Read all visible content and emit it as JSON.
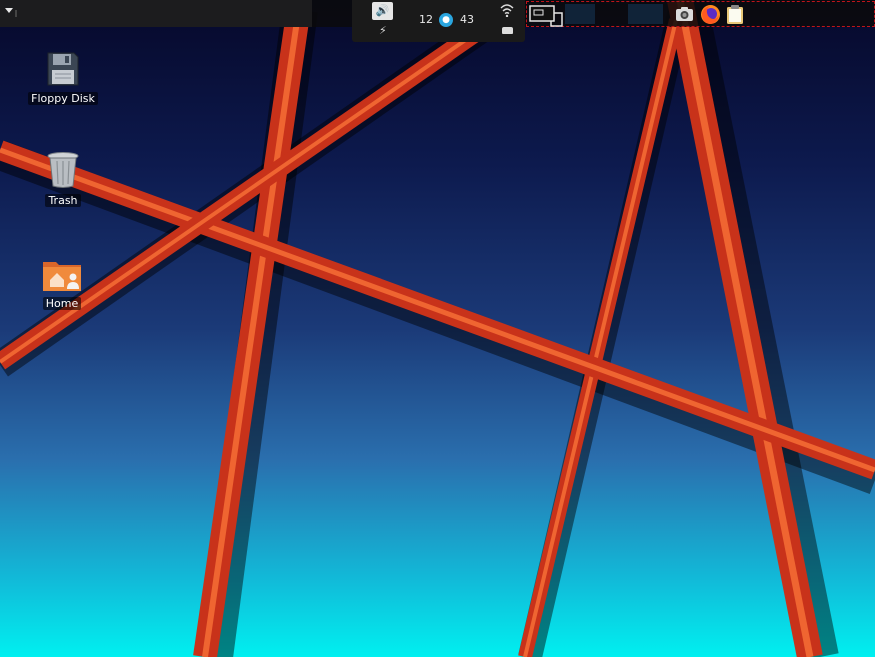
{
  "tray": {
    "number_left": "12",
    "number_right": "43",
    "icons": [
      "volume-icon",
      "charging-icon",
      "update-notifier-icon",
      "wifi-icon",
      "drive-icon"
    ]
  },
  "taskbar": {
    "icons": [
      "window-switcher-icon",
      "screenshot-icon",
      "firefox-icon",
      "clipboard-icon"
    ]
  },
  "desktop": {
    "icons": [
      {
        "label": "Floppy Disk",
        "icon": "floppy-disk-icon"
      },
      {
        "label": "Trash",
        "icon": "trash-icon"
      },
      {
        "label": "Home",
        "icon": "home-folder-icon"
      }
    ]
  },
  "colors": {
    "wallpaper_top": "#06082a",
    "wallpaper_bottom": "#00f0f0",
    "beam": "#c8321a",
    "panel": "#1a1a1a",
    "taskbar_border": "#c0141a"
  }
}
